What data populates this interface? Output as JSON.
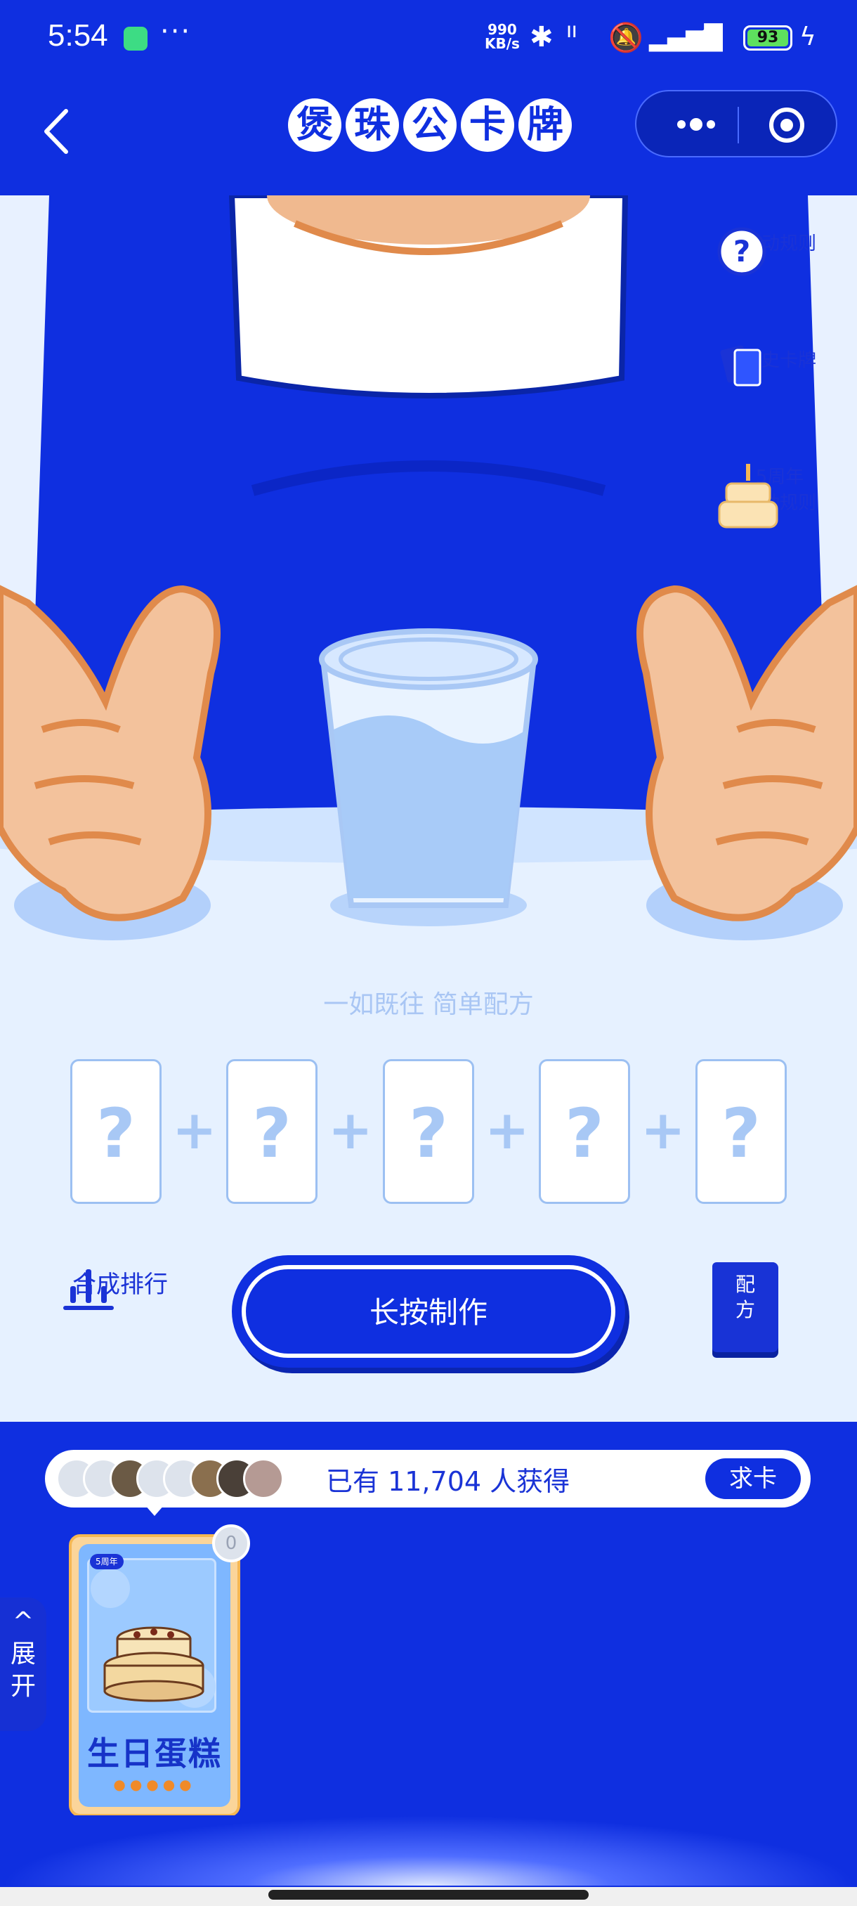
{
  "status_bar": {
    "time": "5:54",
    "more": "···",
    "net_speed_value": "990",
    "net_speed_unit": "KB/s",
    "battery": "93"
  },
  "nav": {
    "title_chars": [
      "煲",
      "珠",
      "公",
      "卡",
      "牌"
    ],
    "more_icon": "ellipsis-icon",
    "close_icon": "target-icon"
  },
  "side_menu": {
    "rules": "活动规则",
    "history": "历史卡牌",
    "anniv_line1": "5周年",
    "anniv_line2": "活动规则"
  },
  "tagline": "一如既往 简单配方",
  "slots": [
    "?",
    "?",
    "?",
    "?",
    "?"
  ],
  "plus": "+",
  "actions": {
    "rank_label": "合成排行",
    "make_button": "长按制作",
    "recipe_line1": "配",
    "recipe_line2": "方"
  },
  "owners": {
    "count_text": "已有 11,704 人获得",
    "ask_button": "求卡"
  },
  "card": {
    "badge": "5周年",
    "name": "生日蛋糕",
    "quantity": "0",
    "flames": 5
  },
  "expand": {
    "arrow": "^",
    "line1": "展",
    "line2": "开"
  },
  "colors": {
    "primary": "#0f2fe0",
    "light_bg": "#e6f1ff",
    "card_gold": "#f5b753"
  }
}
